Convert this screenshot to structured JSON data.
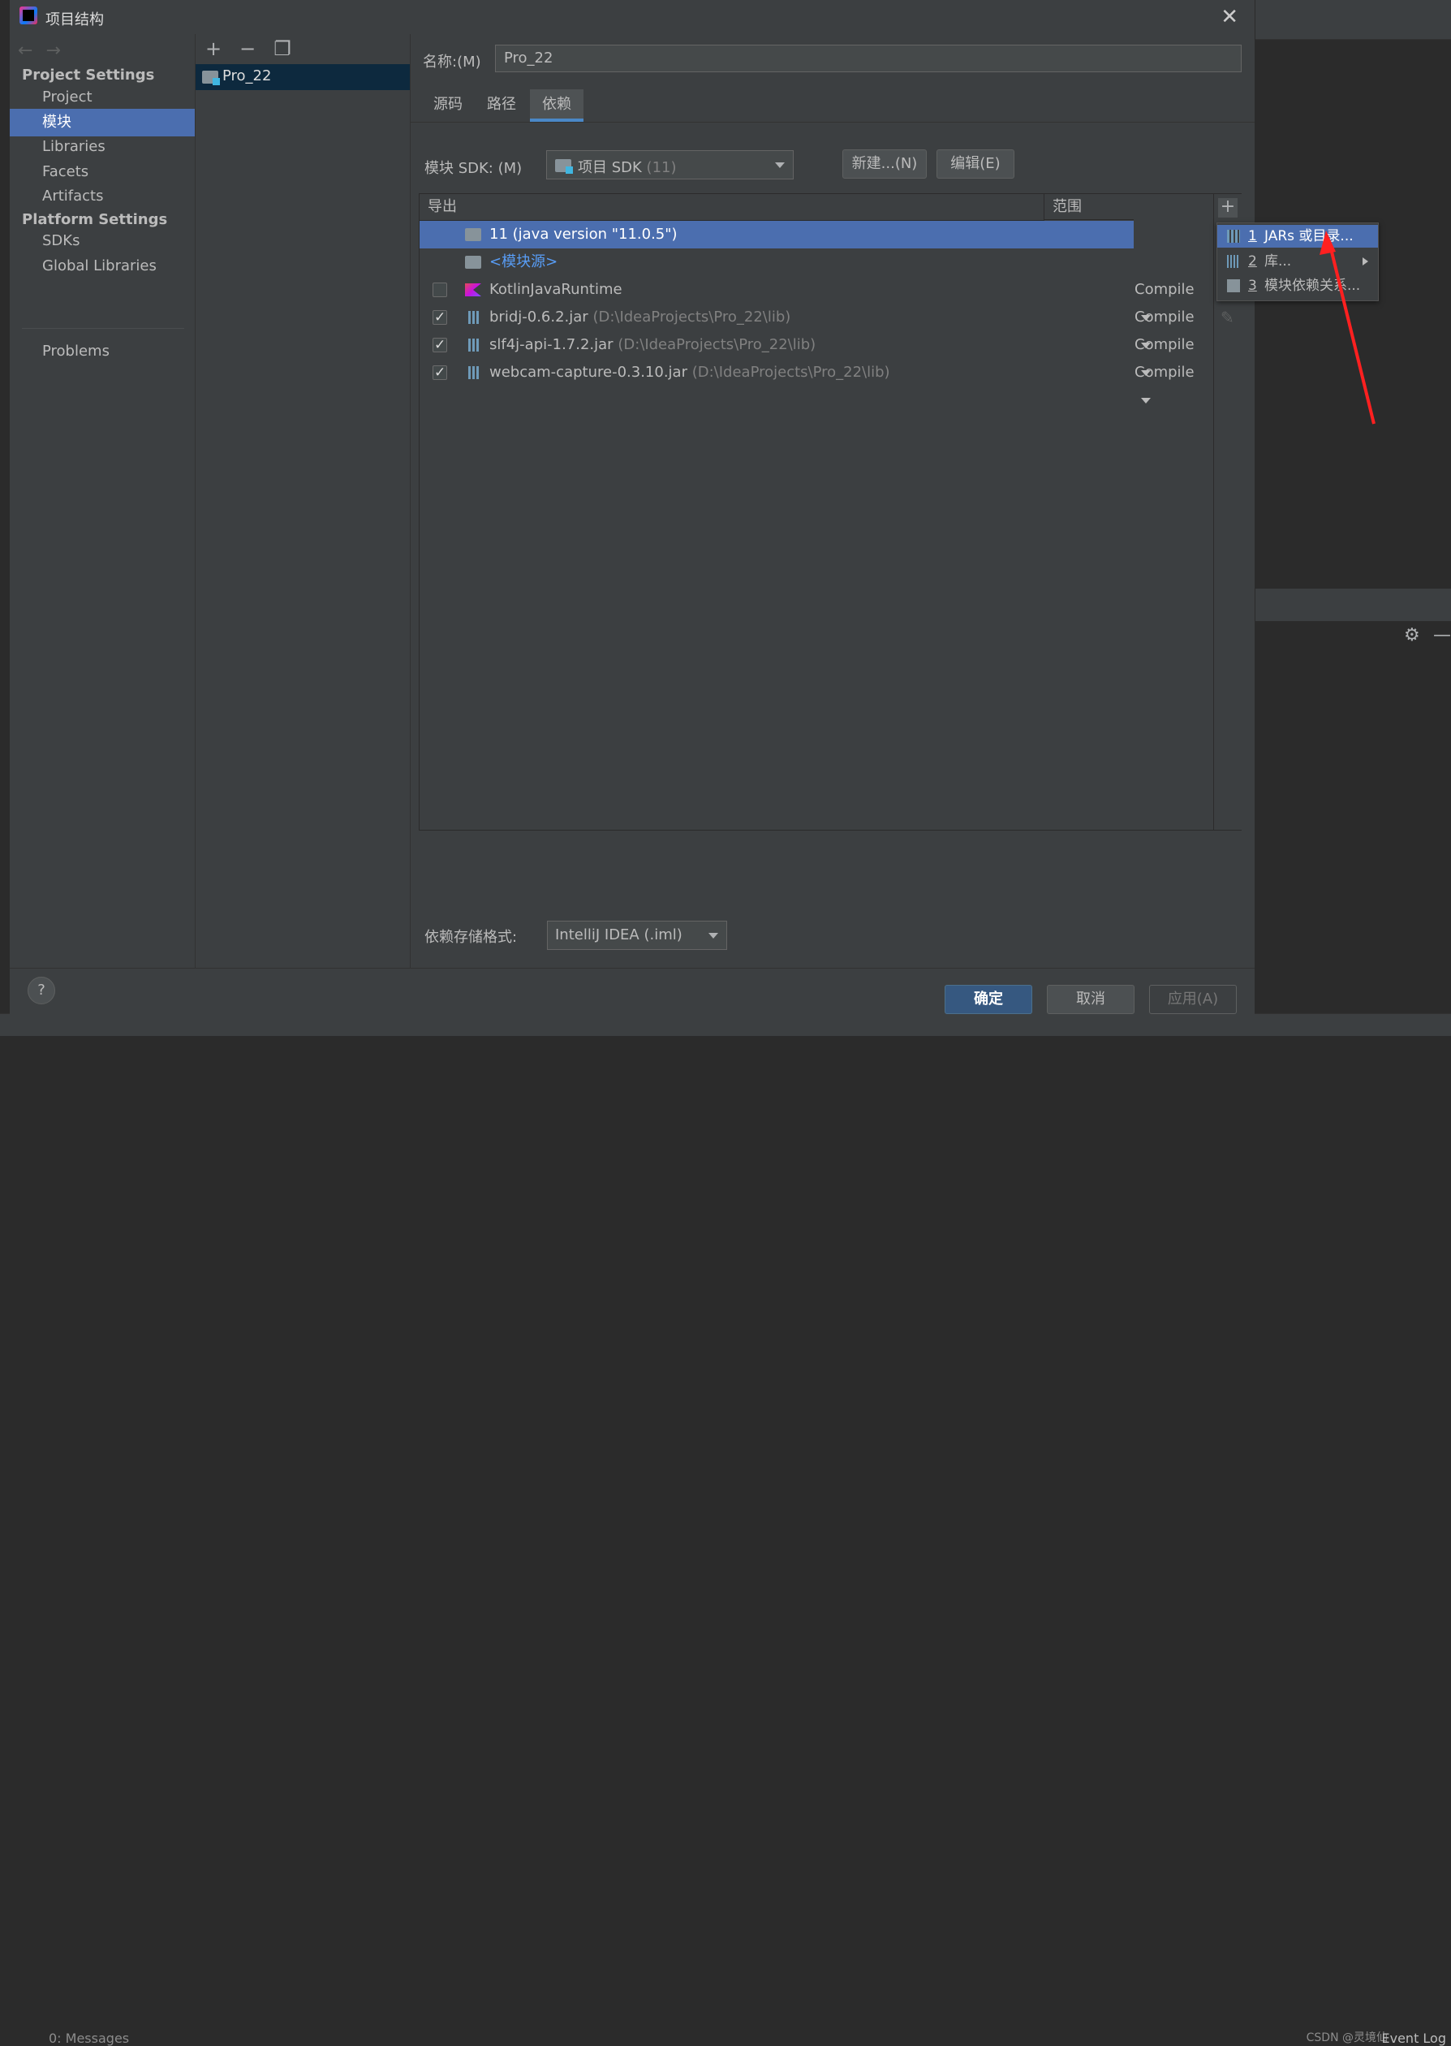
{
  "window": {
    "title": "项目结构"
  },
  "nav": {
    "project_settings_header": "Project Settings",
    "platform_settings_header": "Platform Settings",
    "items": [
      "Project",
      "模块",
      "Libraries",
      "Facets",
      "Artifacts",
      "SDKs",
      "Global Libraries",
      "Problems"
    ]
  },
  "modules": {
    "items": [
      "Pro_22"
    ]
  },
  "form": {
    "name_label": "名称:(M)",
    "name_value": "Pro_22",
    "tabs": [
      "源码",
      "路径",
      "依赖"
    ],
    "active_tab": "依赖",
    "sdk_label": "模块 SDK: (M)",
    "sdk_value": "项目 SDK",
    "sdk_value_dim": "(11)",
    "new_button": "新建...(N)",
    "edit_button": "编辑(E)"
  },
  "deps": {
    "col_export": "导出",
    "col_scope": "范围",
    "rows": [
      {
        "name": "11 (java version \"11.0.5\")",
        "path": "",
        "scope": "",
        "checkbox": "none",
        "selected": true,
        "icon": "folder-icon"
      },
      {
        "name": "<模块源>",
        "path": "",
        "scope": "",
        "checkbox": "none",
        "selected": false,
        "icon": "source-folder-icon"
      },
      {
        "name": "KotlinJavaRuntime",
        "path": "",
        "scope": "Compile",
        "checkbox": "unchecked",
        "selected": false,
        "icon": "kotlin-icon"
      },
      {
        "name": "bridj-0.6.2.jar",
        "path": "(D:\\IdeaProjects\\Pro_22\\lib)",
        "scope": "Compile",
        "checkbox": "checked",
        "selected": false,
        "icon": "jar-icon"
      },
      {
        "name": "slf4j-api-1.7.2.jar",
        "path": "(D:\\IdeaProjects\\Pro_22\\lib)",
        "scope": "Compile",
        "checkbox": "checked",
        "selected": false,
        "icon": "jar-icon"
      },
      {
        "name": "webcam-capture-0.3.10.jar",
        "path": "(D:\\IdeaProjects\\Pro_22\\lib)",
        "scope": "Compile",
        "checkbox": "checked",
        "selected": false,
        "icon": "jar-icon"
      }
    ]
  },
  "popup": {
    "items": [
      {
        "num": "1",
        "label": "JARs 或目录..."
      },
      {
        "num": "2",
        "label": "库..."
      },
      {
        "num": "3",
        "label": "模块依赖关系..."
      }
    ]
  },
  "format": {
    "label": "依赖存储格式:",
    "value": "IntelliJ IDEA (.iml)"
  },
  "footer": {
    "help": "?",
    "ok": "确定",
    "cancel": "取消",
    "apply": "应用(A)"
  },
  "statusbar": {
    "event_log": "Event Log",
    "watermark": "CSDN @灵境仙",
    "messages": "0: Messages"
  },
  "colors": {
    "accent": "#4b6eaf",
    "background": "#3c3f41",
    "annotation_arrow": "#ff2020"
  }
}
